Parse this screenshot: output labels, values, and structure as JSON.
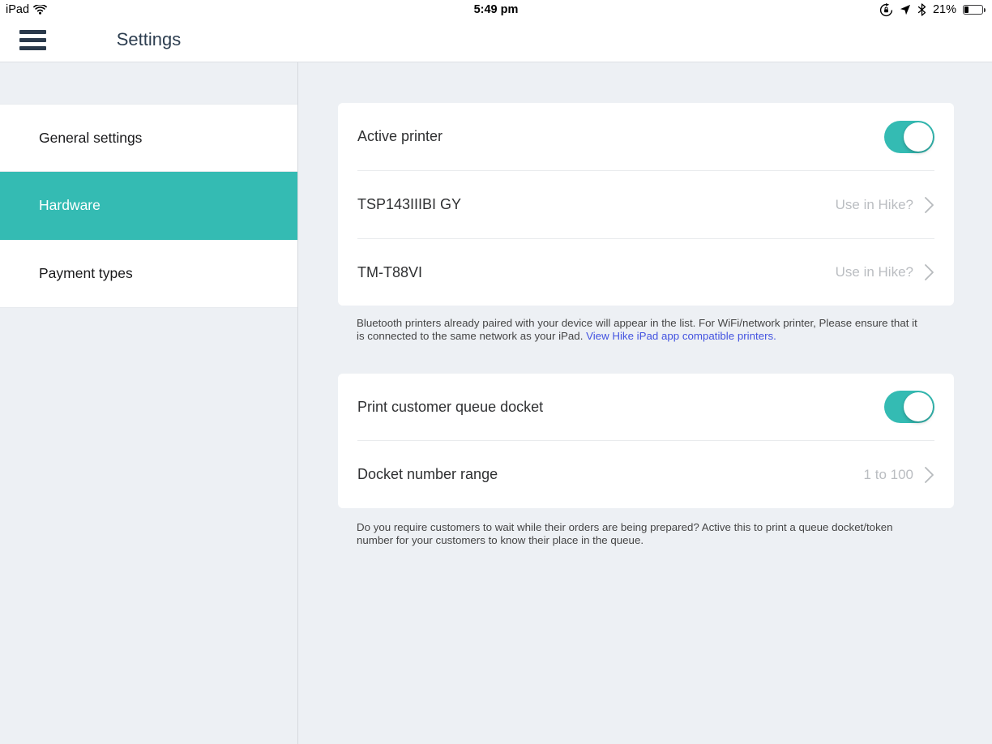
{
  "status_bar": {
    "carrier": "iPad",
    "time": "5:49 pm",
    "battery": "21%"
  },
  "header": {
    "title": "Settings"
  },
  "sidebar": {
    "selected": "Hardware",
    "items": [
      {
        "label": "General settings"
      },
      {
        "label": "Hardware"
      },
      {
        "label": "Payment types"
      }
    ]
  },
  "printer_card": {
    "active_row": {
      "label": "Active printer",
      "toggle_on": true
    },
    "printers": [
      {
        "name": "TSP143IIIBI GY",
        "action": "Use in Hike?"
      },
      {
        "name": "TM-T88VI",
        "action": "Use in Hike?"
      }
    ],
    "help_text": "Bluetooth printers already paired with your device will appear in the list. For WiFi/network printer, Please ensure that it is connected to the same network as your iPad. ",
    "help_link": "View Hike iPad app compatible printers."
  },
  "queue_card": {
    "toggle_row": {
      "label": "Print customer queue docket",
      "toggle_on": true
    },
    "range_row": {
      "label": "Docket number range",
      "value": "1 to 100"
    },
    "help_text": "Do you require customers to wait while their orders are being prepared? Active this to print a queue docket/token number for your customers to know their place in the queue."
  },
  "colors": {
    "accent_teal": "#34bbb3",
    "link_blue": "#4353e0"
  }
}
